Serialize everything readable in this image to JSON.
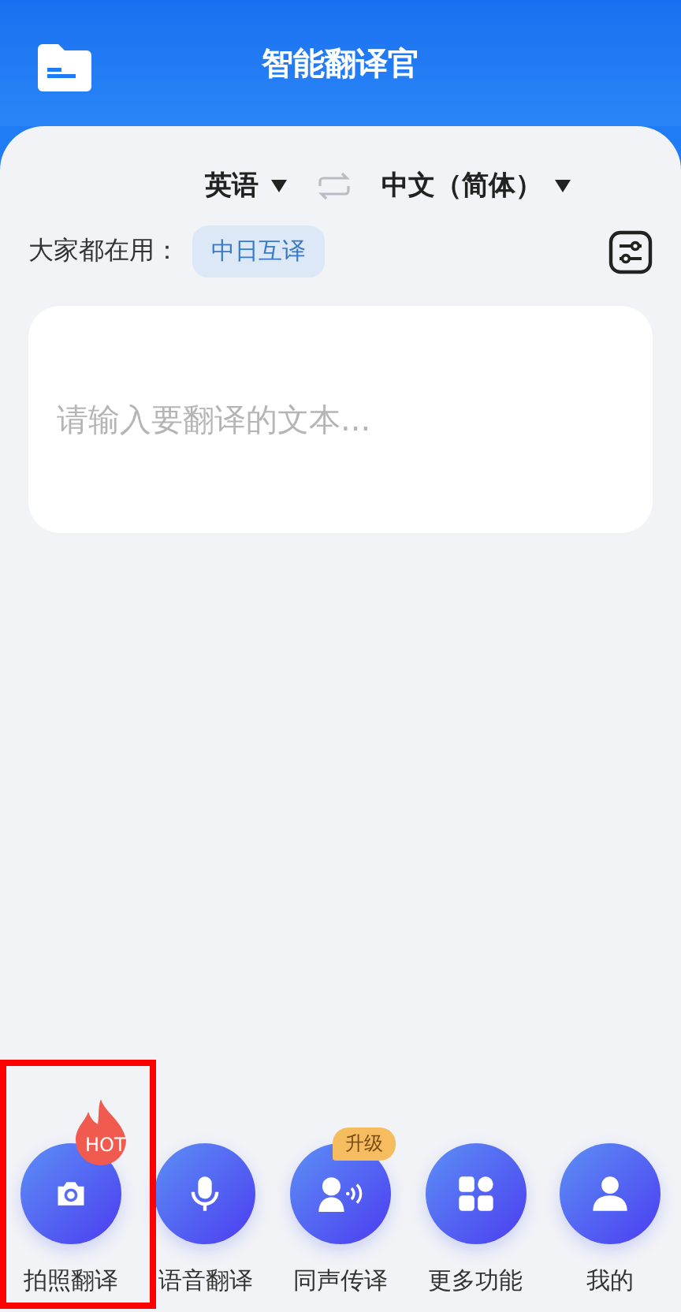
{
  "header": {
    "title": "智能翻译官"
  },
  "languages": {
    "source": "英语",
    "target": "中文（简体）"
  },
  "popular": {
    "label": "大家都在用：",
    "chips": [
      "中日互译"
    ]
  },
  "input": {
    "placeholder": "请输入要翻译的文本..."
  },
  "nav": [
    {
      "label": "拍照翻译",
      "badge": {
        "kind": "hot",
        "text": "HOT"
      }
    },
    {
      "label": "语音翻译"
    },
    {
      "label": "同声传译",
      "badge": {
        "kind": "upgrade",
        "text": "升级"
      }
    },
    {
      "label": "更多功能"
    },
    {
      "label": "我的"
    }
  ],
  "highlight": {
    "shown": true
  }
}
